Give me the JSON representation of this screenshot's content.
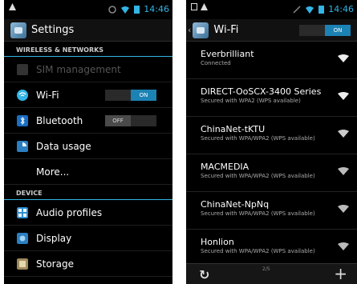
{
  "left": {
    "status_time": "14:46",
    "title": "Settings",
    "section_wireless": "WIRELESS & NETWORKS",
    "section_device": "DEVICE",
    "items": [
      {
        "label": "SIM management"
      },
      {
        "label": "Wi-Fi",
        "toggle": "ON"
      },
      {
        "label": "Bluetooth",
        "toggle": "OFF"
      },
      {
        "label": "Data usage"
      },
      {
        "label": "More..."
      },
      {
        "label": "Audio profiles"
      },
      {
        "label": "Display"
      },
      {
        "label": "Storage"
      }
    ]
  },
  "right": {
    "status_time": "14:46",
    "title": "Wi-Fi",
    "toggle": "ON",
    "page_indicator": "2/5",
    "networks": [
      {
        "name": "Everbrilliant",
        "status": "Connected"
      },
      {
        "name": "DIRECT-OoSCX-3400 Series",
        "status": "Secured with WPA2 (WPS available)"
      },
      {
        "name": "ChinaNet-tKTU",
        "status": "Secured with WPA/WPA2 (WPS available)"
      },
      {
        "name": "MACMEDIA",
        "status": "Secured with WPA/WPA2 (WPS available)"
      },
      {
        "name": "ChinaNet-NpNq",
        "status": "Secured with WPA/WPA2 (WPS available)"
      },
      {
        "name": "Honlion",
        "status": "Secured with WPA/WPA2 (WPS available)"
      }
    ]
  },
  "colors": {
    "accent": "#33b5e5",
    "toggle_on": "#1c82b4"
  }
}
